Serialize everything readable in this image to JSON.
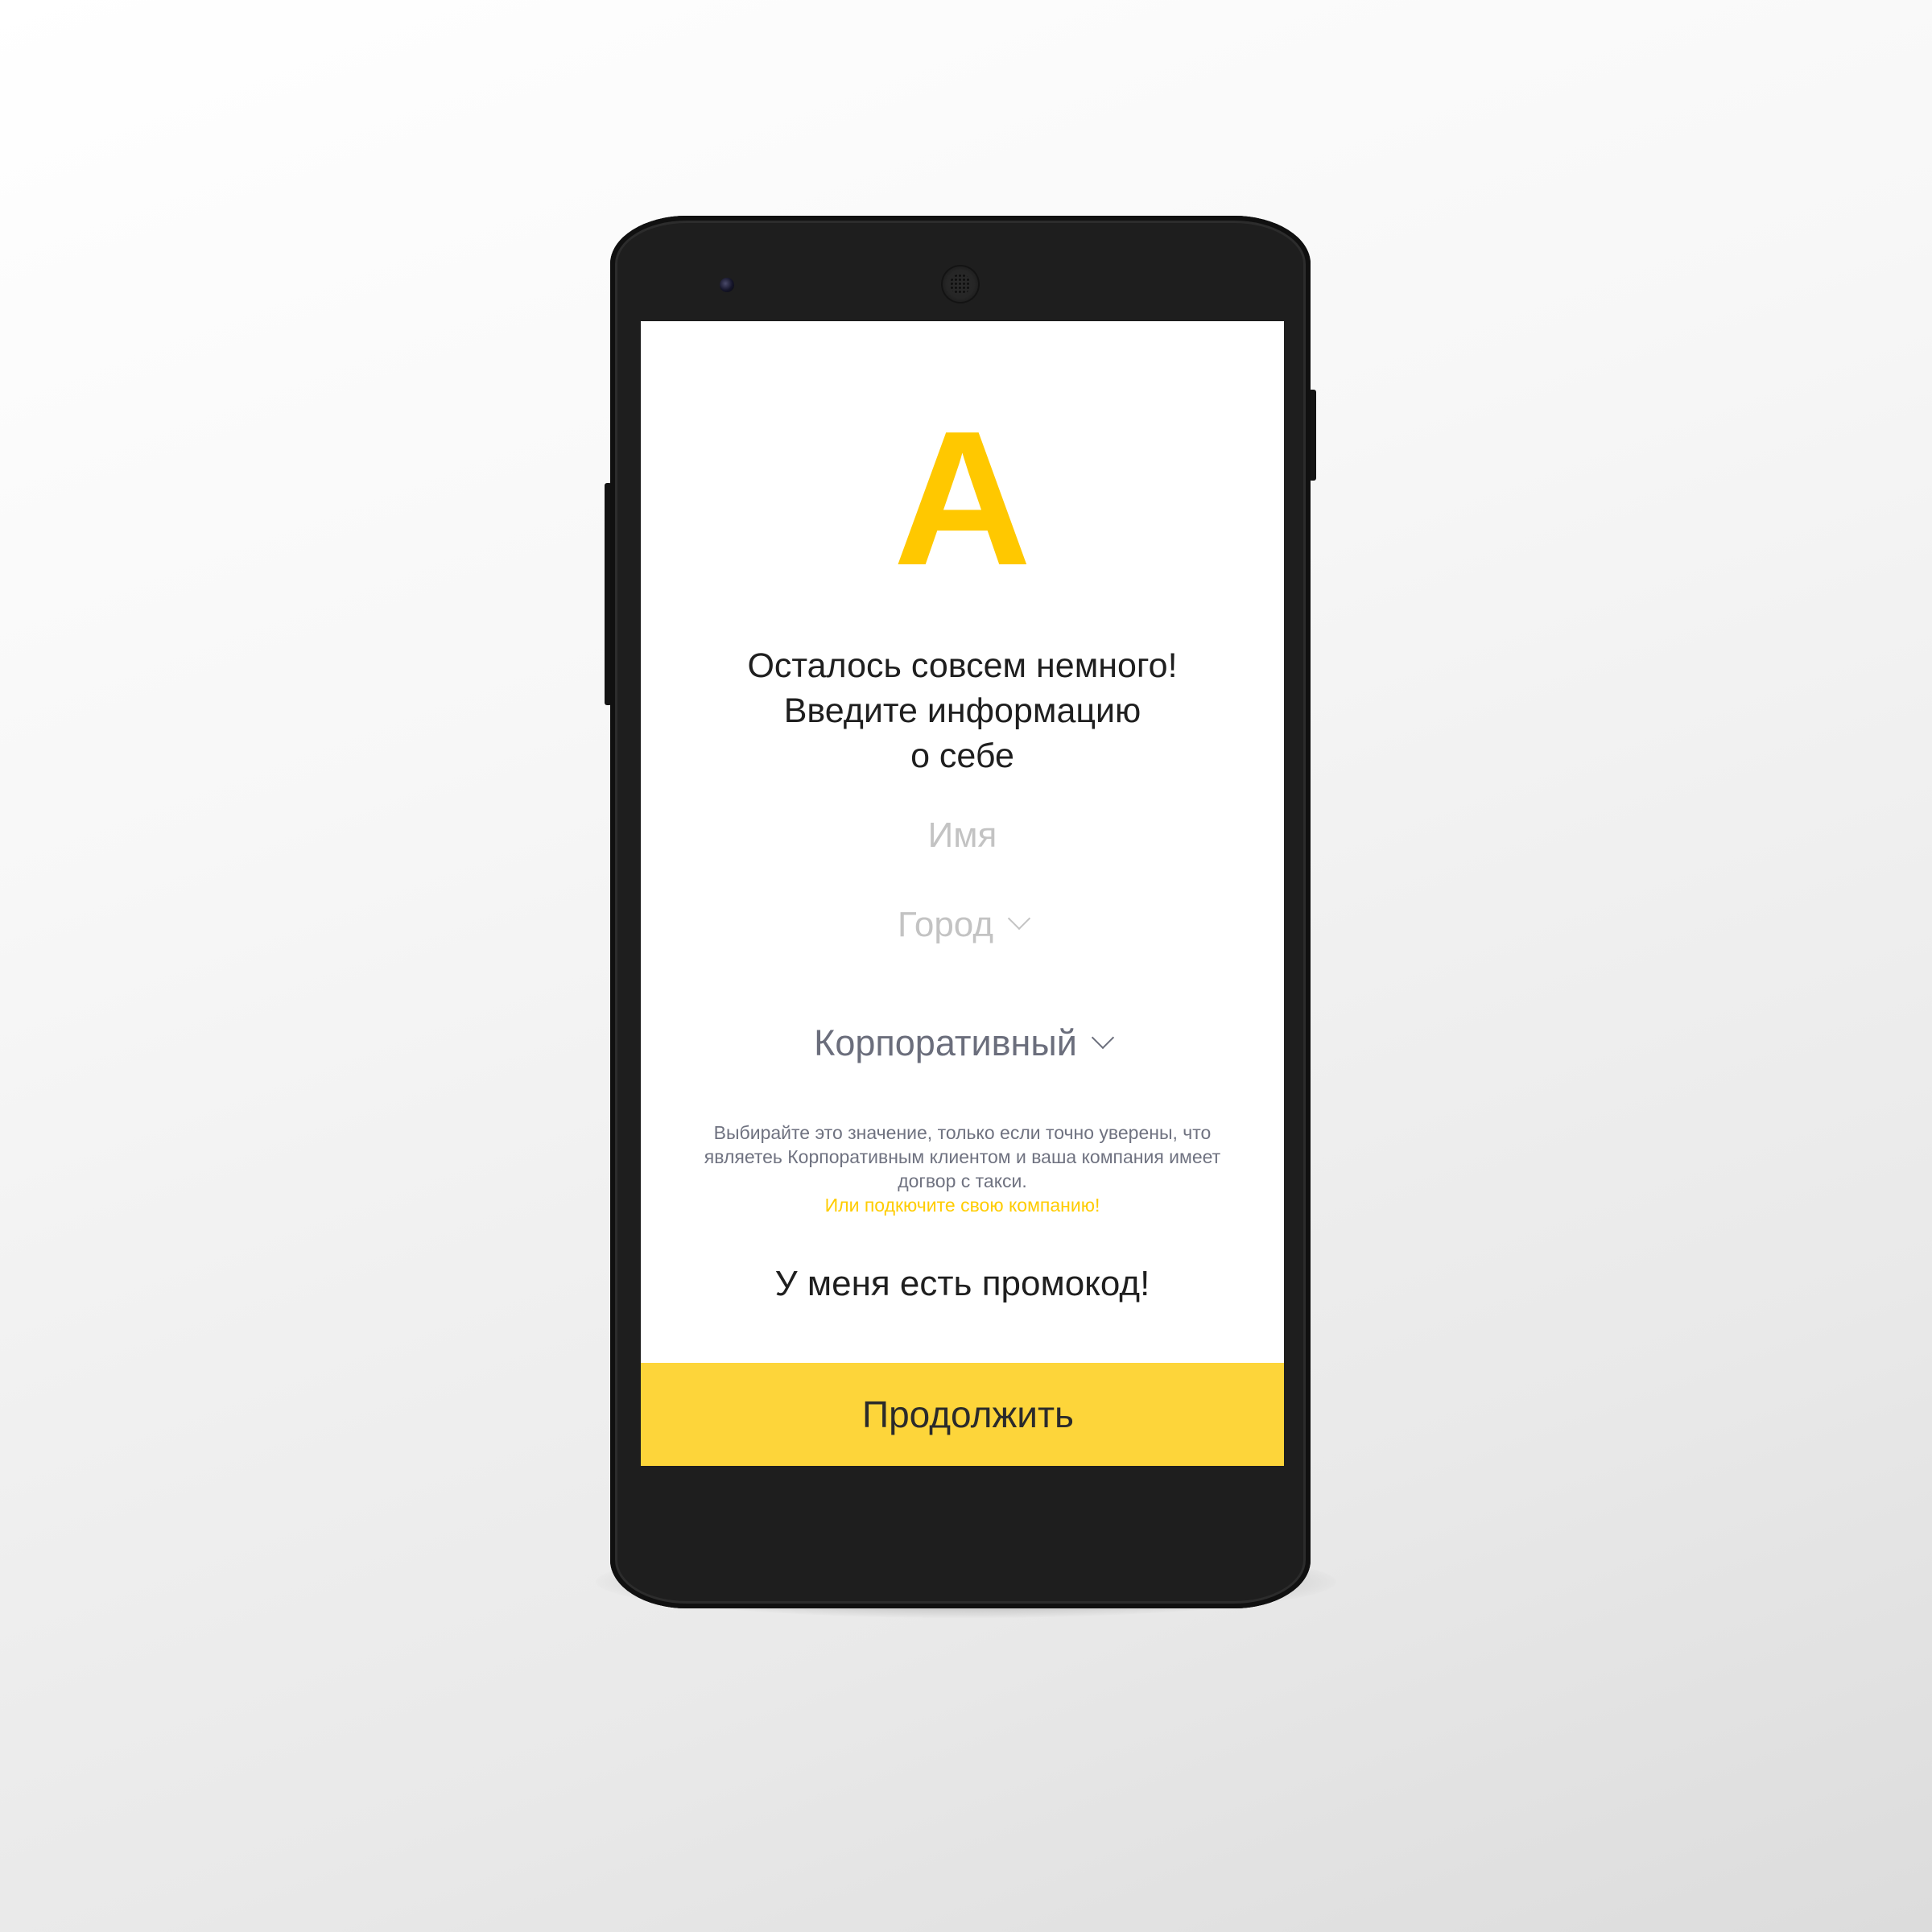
{
  "app": {
    "logo_letter": "A",
    "accent_color": "#ffc800",
    "button_color": "#fdd53a"
  },
  "form": {
    "heading_lines": [
      "Осталось совсем немного!",
      "Введите информацию",
      "о себе"
    ],
    "name_field": {
      "placeholder": "Имя"
    },
    "city_select": {
      "placeholder": "Город",
      "icon": "chevron-down-icon"
    },
    "client_type_select": {
      "value": "Корпоративный",
      "icon": "chevron-down-icon"
    },
    "hint_lines": [
      "Выбирайте это значение, только если точно уверены, что",
      "являетеь Корпоративным клиентом и ваша компания имеет",
      "догвор с такси."
    ],
    "connect_company_link": "Или подкючите свою компанию!",
    "promo_link": "У меня есть промокод!",
    "continue_label": "Продолжить"
  }
}
